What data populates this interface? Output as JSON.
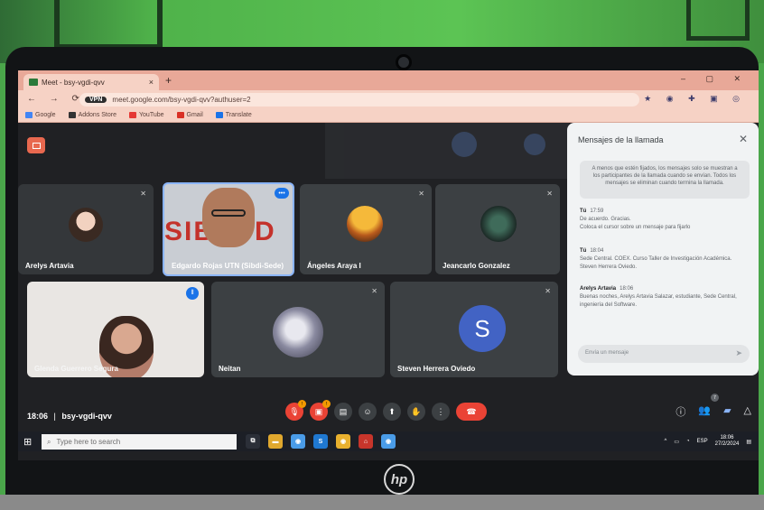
{
  "browser": {
    "tab_title": "Meet - bsy-vgdi-qvv",
    "tab_close": "×",
    "new_tab": "+",
    "window_controls": "– ▢ ✕",
    "nav_buttons": "← → ⟳",
    "vpn_label": "VPN",
    "url": "meet.google.com/bsy-vgdi-qvv?authuser=2",
    "extension_icons": "★ ◉ ✚ ▣ ◎",
    "bookmarks": [
      "Google",
      "Addons Store",
      "YouTube",
      "Gmail",
      "Translate"
    ]
  },
  "participants": [
    {
      "name": "Arelys Artavia"
    },
    {
      "name": "Edgardo Rojas UTN (Sibdi-Sede)"
    },
    {
      "name": "Ángeles Araya I"
    },
    {
      "name": "Jeancarlo Gonzalez"
    },
    {
      "name": "Glenda Guerrero Segura"
    },
    {
      "name": "Neitan"
    },
    {
      "name": "Steven Herrera Oviedo",
      "initial": "S"
    }
  ],
  "banner_text": "SIBDFD",
  "chat": {
    "title": "Mensajes de la llamada",
    "close": "✕",
    "notice": "A menos que estén fijados, los mensajes solo se muestran a los participantes de la llamada cuando se envían. Todos los mensajes se eliminan cuando termina la llamada.",
    "messages": [
      {
        "sender": "Tú",
        "time": "17:59",
        "lines": [
          "De acuerdo. Gracias.",
          "Coloca el cursor sobre un mensaje para fijarlo"
        ]
      },
      {
        "sender": "Tú",
        "time": "18:04",
        "lines": [
          "Sede Central. COEX. Curso Taller de Investigación Académica. Steven Herrera Oviedo."
        ]
      },
      {
        "sender": "Arelys Artavia",
        "time": "18:06",
        "lines": [
          "Buenas noches, Arelys Artavia Salazar, estudiante, Sede Central, ingeniería del Software."
        ]
      }
    ],
    "input_placeholder": "Envía un mensaje",
    "send_icon": "➤"
  },
  "meeting": {
    "time": "18:06",
    "code": "bsy-vgdi-qvv",
    "people_count": "7"
  },
  "taskbar": {
    "search_placeholder": "Type here to search",
    "language": "ESP",
    "clock_time": "18:06",
    "clock_date": "27/2/2024"
  },
  "hp_logo": "hp"
}
